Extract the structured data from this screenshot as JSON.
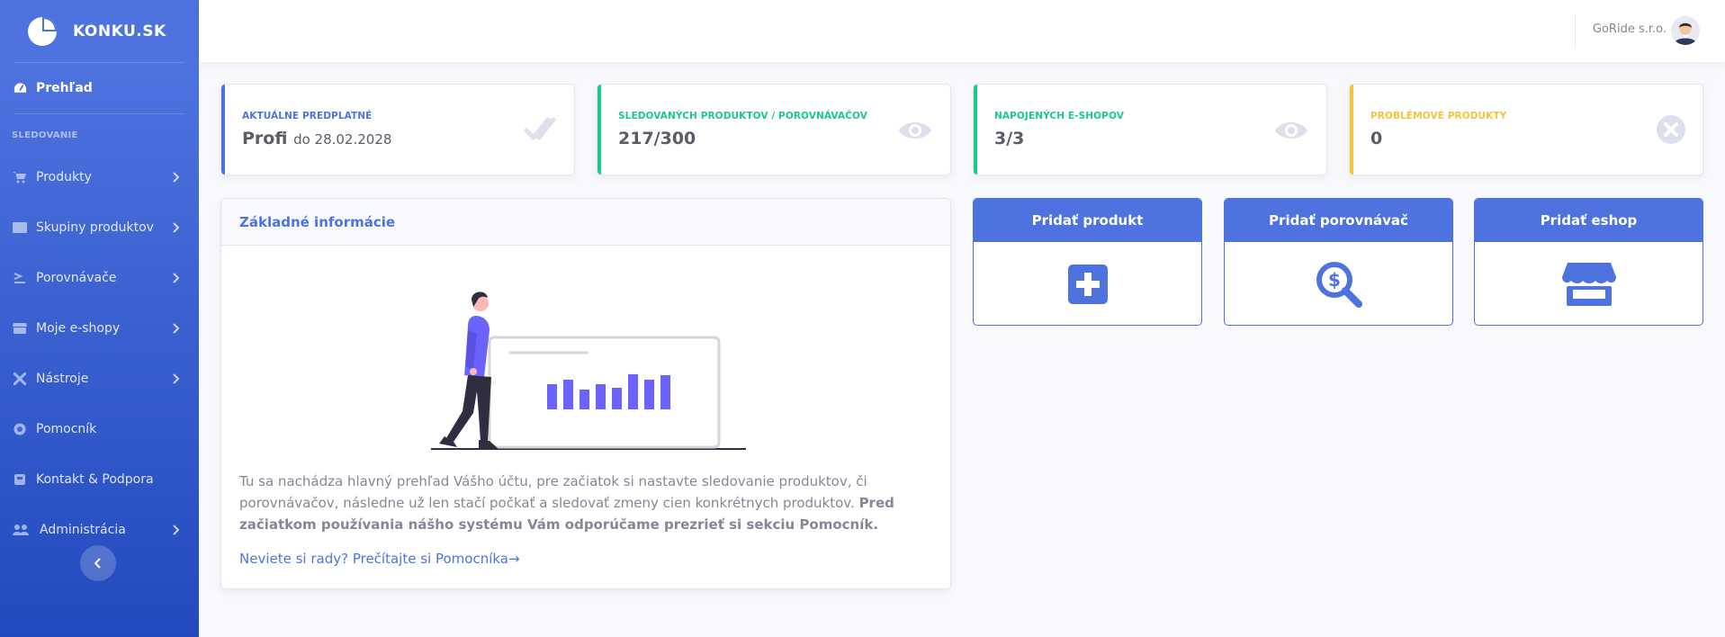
{
  "brand": {
    "name": "KONKU.SK"
  },
  "sidebar": {
    "active_item": "Prehľad",
    "section_heading": "SLEDOVANIE",
    "items": [
      {
        "label": "Produkty",
        "icon": "cart-icon",
        "has_chevron": true
      },
      {
        "label": "Skupiny produktov",
        "icon": "list-icon",
        "has_chevron": true
      },
      {
        "label": "Porovnávače",
        "icon": "compare-icon",
        "has_chevron": true
      },
      {
        "label": "Moje e-shopy",
        "icon": "store-icon",
        "has_chevron": true
      },
      {
        "label": "Nástroje",
        "icon": "tools-icon",
        "has_chevron": true
      },
      {
        "label": "Pomocník",
        "icon": "help-icon",
        "has_chevron": false
      },
      {
        "label": "Kontakt & Podpora",
        "icon": "support-icon",
        "has_chevron": false
      },
      {
        "label": "Administrácia",
        "icon": "users-cog-icon",
        "has_chevron": true
      }
    ]
  },
  "topbar": {
    "user_name": "GoRide s.r.o."
  },
  "stats": [
    {
      "label": "AKTUÁLNE PREDPLATNÉ",
      "value": "Profi",
      "sub": "do 28.02.2028",
      "color": "#4e73df",
      "icon": "check-double-icon"
    },
    {
      "label": "SLEDOVANÝCH PRODUKTOV / POROVNÁVAČOV",
      "value": "217/300",
      "sub": "",
      "color": "#1cc88a",
      "icon": "eye-icon"
    },
    {
      "label": "NAPOJENÝCH E-SHOPOV",
      "value": "3/3",
      "sub": "",
      "color": "#1cc88a",
      "icon": "eye-icon"
    },
    {
      "label": "PROBLÉMOVÉ PRODUKTY",
      "value": "0",
      "sub": "",
      "color": "#f6c23e",
      "icon": "times-circle-icon"
    }
  ],
  "info": {
    "title": "Základné informácie",
    "text_plain": "Tu sa nachádza hlavný prehľad Vášho účtu, pre začiatok si nastavte sledovanie produktov, či porovnávačov, následne už len stačí počkať a sledovať zmeny cien konkrétnych produktov.",
    "text_bold": "Pred začiatkom používania nášho systému Vám odporúčame prezrieť si sekciu Pomocník.",
    "link": "Neviete si rady? Prečítajte si Pomocníka→"
  },
  "actions": [
    {
      "label": "Pridať produkt",
      "icon": "plus-square-icon"
    },
    {
      "label": "Pridať porovnávač",
      "icon": "search-dollar-icon"
    },
    {
      "label": "Pridať eshop",
      "icon": "store-icon"
    }
  ],
  "colors": {
    "primary": "#4e73df",
    "success": "#1cc88a",
    "warning": "#f6c23e",
    "illustration_accent": "#6c63ff"
  }
}
